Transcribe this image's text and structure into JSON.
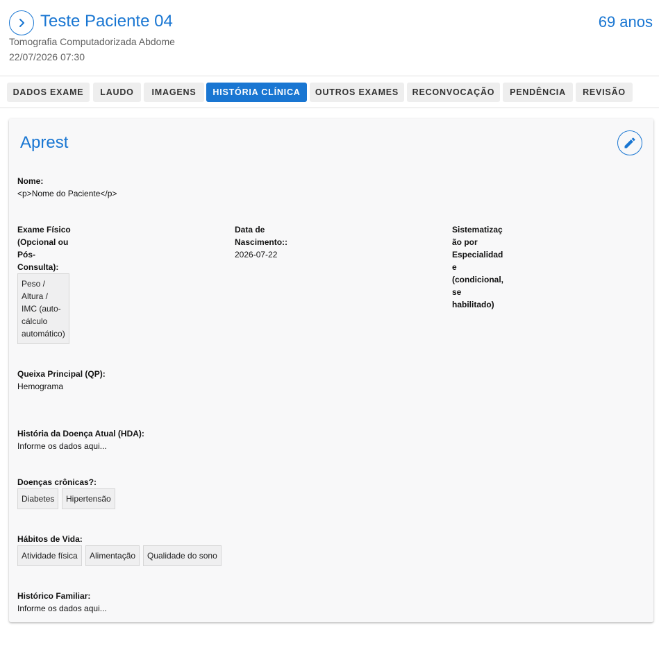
{
  "header": {
    "patient_name": "Teste Paciente 04",
    "age": "69 anos",
    "exam_type": "Tomografia Computadorizada Abdome",
    "exam_datetime": "22/07/2026 07:30"
  },
  "tabs": [
    {
      "label": "DADOS EXAME",
      "active": false
    },
    {
      "label": "LAUDO",
      "active": false
    },
    {
      "label": "IMAGENS",
      "active": false
    },
    {
      "label": "HISTÓRIA CLÍNICA",
      "active": true
    },
    {
      "label": "OUTROS EXAMES",
      "active": false
    },
    {
      "label": "RECONVOCAÇÃO",
      "active": false
    },
    {
      "label": "PENDÊNCIA",
      "active": false
    },
    {
      "label": "REVISÃO",
      "active": false
    }
  ],
  "card": {
    "title": "Aprest",
    "nome": {
      "label": "Nome:",
      "value": "<p>Nome do Paciente</p>"
    },
    "exame_fisico": {
      "label_lines": [
        "Exame Físico",
        "(Opcional ou",
        "Pós-",
        "Consulta):"
      ],
      "chip_lines": [
        "Peso /",
        "Altura /",
        "IMC (auto-",
        "cálculo",
        "automático)"
      ]
    },
    "data_nascimento": {
      "label_lines": [
        "Data de",
        "Nascimento::"
      ],
      "value": "2026-07-22"
    },
    "sistematizacao": {
      "label_lines": [
        "Sistematizaç",
        "ão por",
        "Especialidad",
        "e",
        "(condicional,",
        "se",
        "habilitado)"
      ]
    },
    "queixa": {
      "label": "Queixa Principal (QP):",
      "value": "Hemograma"
    },
    "hda": {
      "label": "História da Doença Atual (HDA):",
      "value": "Informe os dados aqui..."
    },
    "doencas": {
      "label": "Doenças crônicas?:",
      "chips": [
        "Diabetes",
        "Hipertensão"
      ]
    },
    "habitos": {
      "label": "Hábitos de Vida:",
      "chips": [
        "Atividade física",
        "Alimentação",
        "Qualidade do sono"
      ]
    },
    "historico": {
      "label": "Histórico Familiar:",
      "value": "Informe os dados aqui..."
    }
  },
  "colors": {
    "accent": "#1976d2",
    "tab_bg": "#eeeeee",
    "card_bg": "#f8f8f9"
  },
  "icons": {
    "back": "chevron-right-icon",
    "edit": "pencil-icon"
  }
}
